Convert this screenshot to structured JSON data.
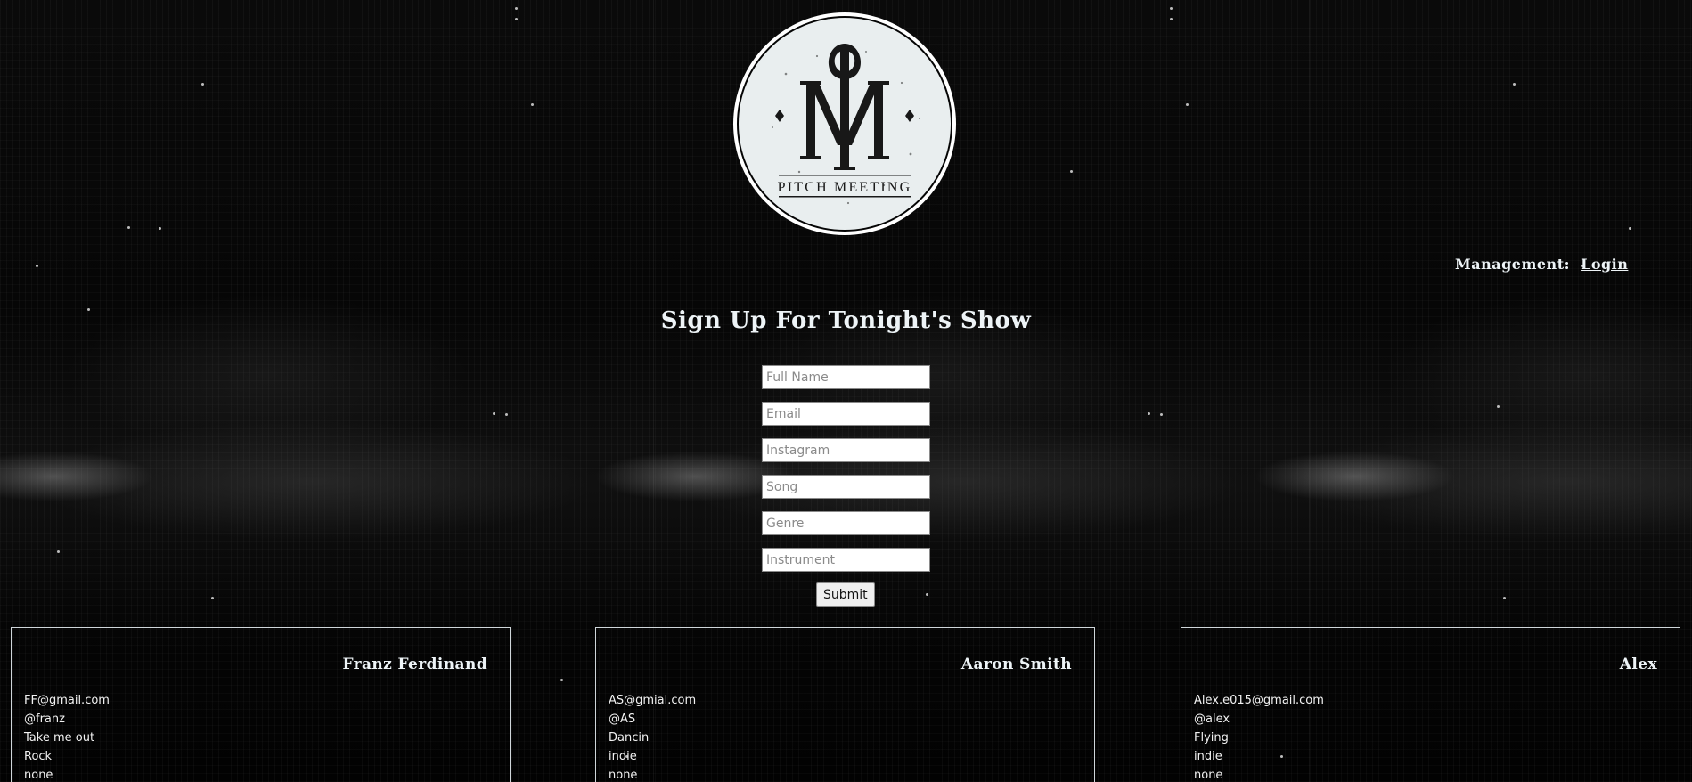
{
  "header": {
    "logo_text": "PITCH MEETING",
    "management_label": "Management:",
    "login_link": "Login"
  },
  "signup": {
    "title": "Sign Up For Tonight's Show",
    "fields": {
      "full_name": "Full Name",
      "email": "Email",
      "instagram": "Instagram",
      "song": "Song",
      "genre": "Genre",
      "instrument": "Instrument"
    },
    "submit_label": "Submit"
  },
  "performers": [
    {
      "name": "Franz Ferdinand",
      "email": "FF@gmail.com",
      "instagram": "@franz",
      "song": "Take me out",
      "genre": "Rock",
      "instrument": "none"
    },
    {
      "name": "Aaron Smith",
      "email": "AS@gmial.com",
      "instagram": "@AS",
      "song": "Dancin",
      "genre": "indie",
      "instrument": "none"
    },
    {
      "name": "Alex",
      "email": "Alex.e015@gmail.com",
      "instagram": "@alex",
      "song": "Flying",
      "genre": "indie",
      "instrument": "none"
    }
  ],
  "colors": {
    "background": "#050505",
    "text_light": "#eef4f7",
    "card_border": "#cfd6da"
  }
}
